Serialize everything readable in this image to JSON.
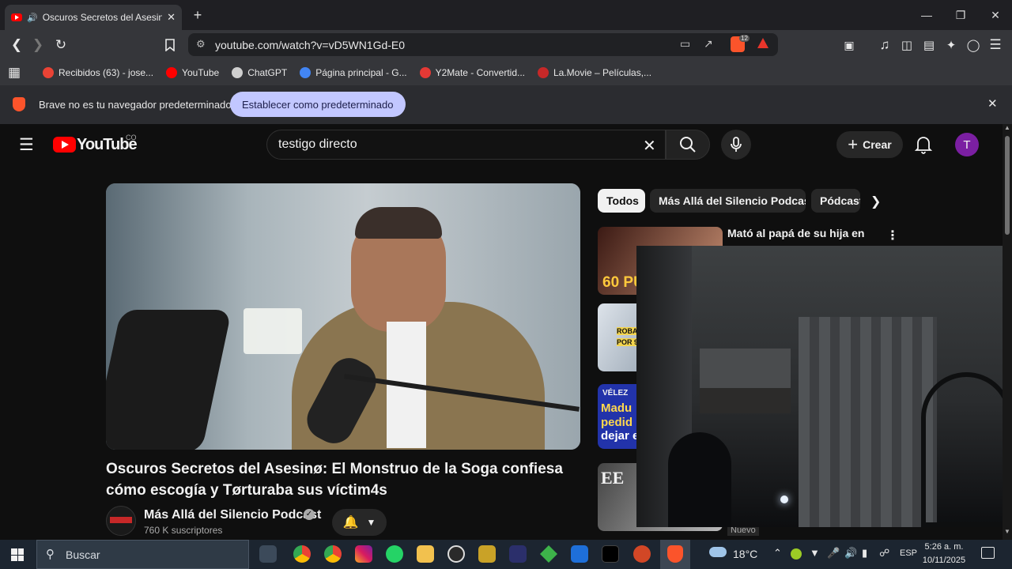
{
  "browser": {
    "tab_title": "Oscuros Secretos del Asesinø",
    "new_tab_glyph": "+",
    "url": "youtube.com/watch?v=vD5WN1Gd-E0",
    "brave_badge": "12",
    "bookmarks": [
      {
        "label": "Recibidos (63) - jose...",
        "icon": "gmail-icon",
        "color": "#ea4335"
      },
      {
        "label": "YouTube",
        "icon": "youtube-icon",
        "color": "#ff0000"
      },
      {
        "label": "ChatGPT",
        "icon": "chatgpt-icon",
        "color": "#cfcfcf"
      },
      {
        "label": "Página principal - G...",
        "icon": "google-icon",
        "color": "#4285f4"
      },
      {
        "label": "Y2Mate - Convertid...",
        "icon": "y2mate-icon",
        "color": "#e53935"
      },
      {
        "label": "La.Movie – Películas,...",
        "icon": "lamovie-icon",
        "color": "#c62828"
      }
    ],
    "infobar": {
      "message": "Brave no es tu navegador predeterminado",
      "button": "Establecer como predeterminado"
    }
  },
  "youtube": {
    "logo_text": "YouTube",
    "country": "CO",
    "search_value": "testigo directo",
    "create_label": "Crear",
    "avatar_letter": "T",
    "video": {
      "title": "Oscuros Secretos del Asesinø: El Monstruo de la Soga confiesa cómo escogía y Tørturaba sus víctim4s",
      "channel": "Más Allá del Silencio Podcast",
      "subscribers": "760 K suscriptores"
    },
    "chips": [
      "Todos",
      "Más Allá del Silencio Podcast",
      "Pódcast"
    ],
    "side": {
      "first_title_line": "Mató al papá de su hija en",
      "thumb1_text": "60 PU",
      "thumb2_text_1": "ROBAMO",
      "thumb2_text_2": "POR 9.0",
      "thumb3_text_1": "VÉLEZ",
      "thumb3_text_2": "Madu",
      "thumb3_text_3": "pedid",
      "thumb3_text_4": "dejar e",
      "thumb4_text": "EE",
      "badge_new": "Nuevo"
    }
  },
  "taskbar": {
    "search_placeholder": "Buscar",
    "weather": "18°C",
    "language": "ESP",
    "time": "5:26 a. m.",
    "date": "10/11/2025"
  }
}
